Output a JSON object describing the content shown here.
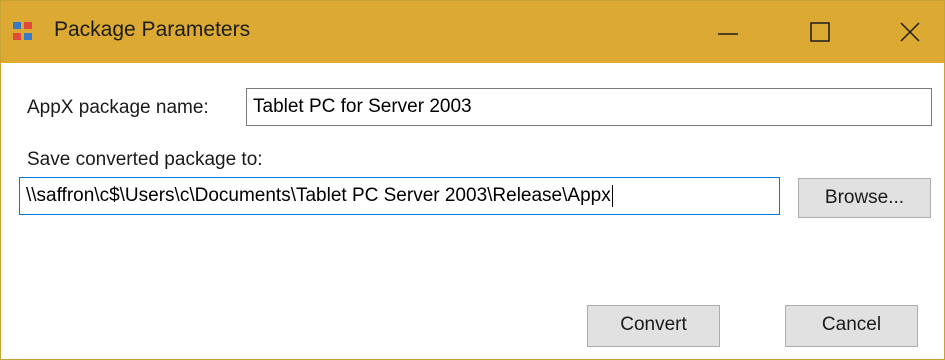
{
  "window": {
    "title": "Package Parameters",
    "icon": "app-window-icon",
    "controls": [
      "minimize-icon",
      "maximize-icon",
      "close-icon"
    ]
  },
  "form": {
    "name_label": "AppX package name:",
    "name_value": "Tablet PC for Server 2003",
    "path_label": "Save converted package to:",
    "path_value": "\\\\saffron\\c$\\Users\\c\\Documents\\Tablet PC Server 2003\\Release\\Appx",
    "browse_label": "Browse..."
  },
  "buttons": {
    "convert_label": "Convert",
    "cancel_label": "Cancel"
  },
  "colors": {
    "titlebar": "#dcaa32",
    "focus_border": "#0078d7",
    "button_face": "#e1e1e1"
  }
}
